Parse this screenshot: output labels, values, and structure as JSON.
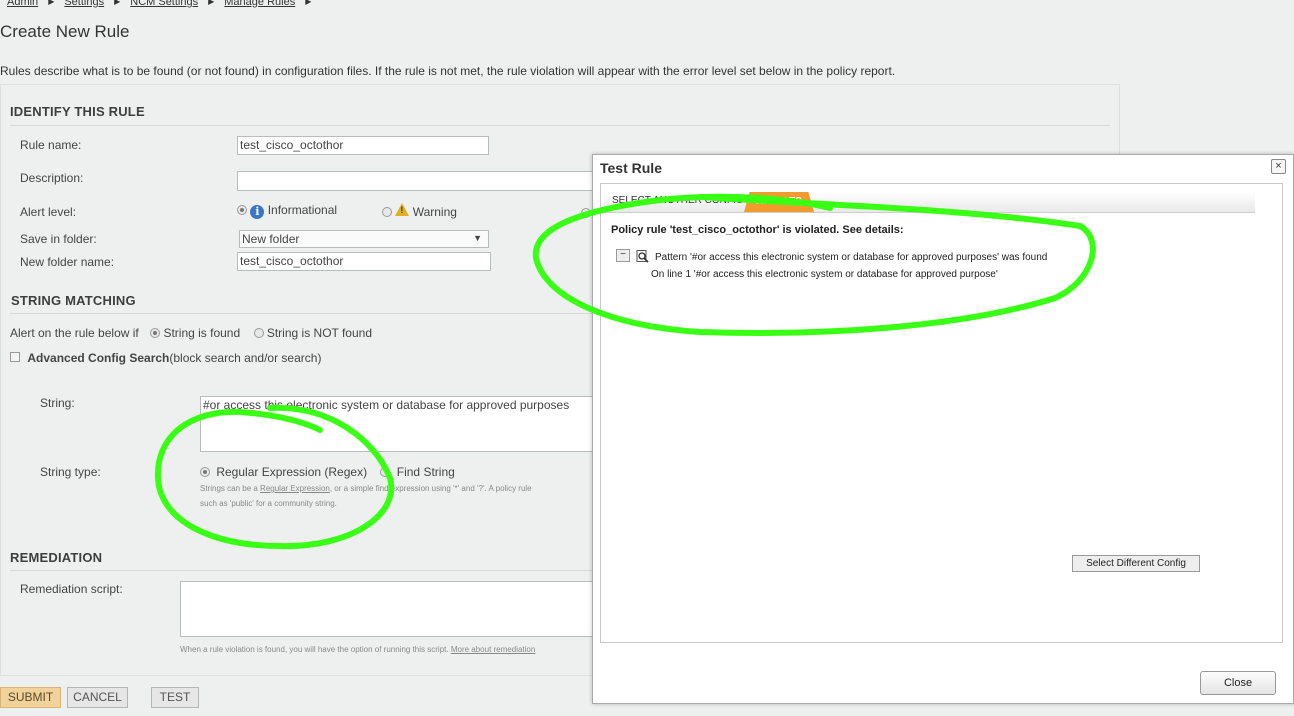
{
  "breadcrumb": [
    "Admin",
    "Settings",
    "NCM Settings",
    "Manage Rules"
  ],
  "page_title": "Create New Rule",
  "intro": "Rules describe what is to be found (or not found) in configuration files. If the rule is not met, the rule violation will appear with the error level set below in the policy report.",
  "identify": {
    "heading": "IDENTIFY THIS RULE",
    "rule_name_label": "Rule name:",
    "rule_name_value": "test_cisco_octothor",
    "description_label": "Description:",
    "alert_level_label": "Alert level:",
    "alert_informational": "Informational",
    "alert_warning": "Warning",
    "save_folder_label": "Save in folder:",
    "save_folder_value": "New folder",
    "new_folder_label": "New folder name:",
    "new_folder_value": "test_cisco_octothor"
  },
  "string_matching": {
    "heading": "STRING MATCHING",
    "alert_if_label": "Alert on the rule below if",
    "opt_found": "String is found",
    "opt_not_found": "String is NOT found",
    "advanced_label": "Advanced Config Search",
    "advanced_suffix": "(block search and/or search)",
    "string_label": "String:",
    "string_value": "#or access this electronic system or database for approved purposes",
    "string_type_label": "String type:",
    "type_regex": "Regular Expression (Regex)",
    "type_find": "Find String",
    "hint_prefix": "Strings can be a ",
    "hint_link": "Regular Expression",
    "hint_mid": ", or a simple find expression using '*' and '?'. A policy rule",
    "hint_line2": "such as 'public' for a community string."
  },
  "remediation": {
    "heading": "REMEDIATION",
    "script_label": "Remediation script:",
    "hint": "When a rule violation is found, you will have the option of running this script. ",
    "hint_link": "More about remediation"
  },
  "buttons": {
    "submit": "SUBMIT",
    "cancel": "CANCEL",
    "test": "TEST"
  },
  "dialog": {
    "title": "Test Rule",
    "close_x": "×",
    "tab_select": "SELECT ANOTHER CONFIG",
    "tab_results": "RESULTS",
    "violation": "Policy rule 'test_cisco_octothor' is violated. See details:",
    "expand_toggle": "−",
    "pattern_line": "Pattern '#or access this electronic system or database for approved purposes' was found",
    "line_detail": "On line 1 '#or access this electronic system or database for approved purpose'",
    "select_config_button": "Select Different Config",
    "close_button": "Close"
  },
  "colors": {
    "annotation": "#39ff14",
    "results_tab": "#f39a2c",
    "submit": "#f2d29b",
    "info": "#3a76c4"
  }
}
